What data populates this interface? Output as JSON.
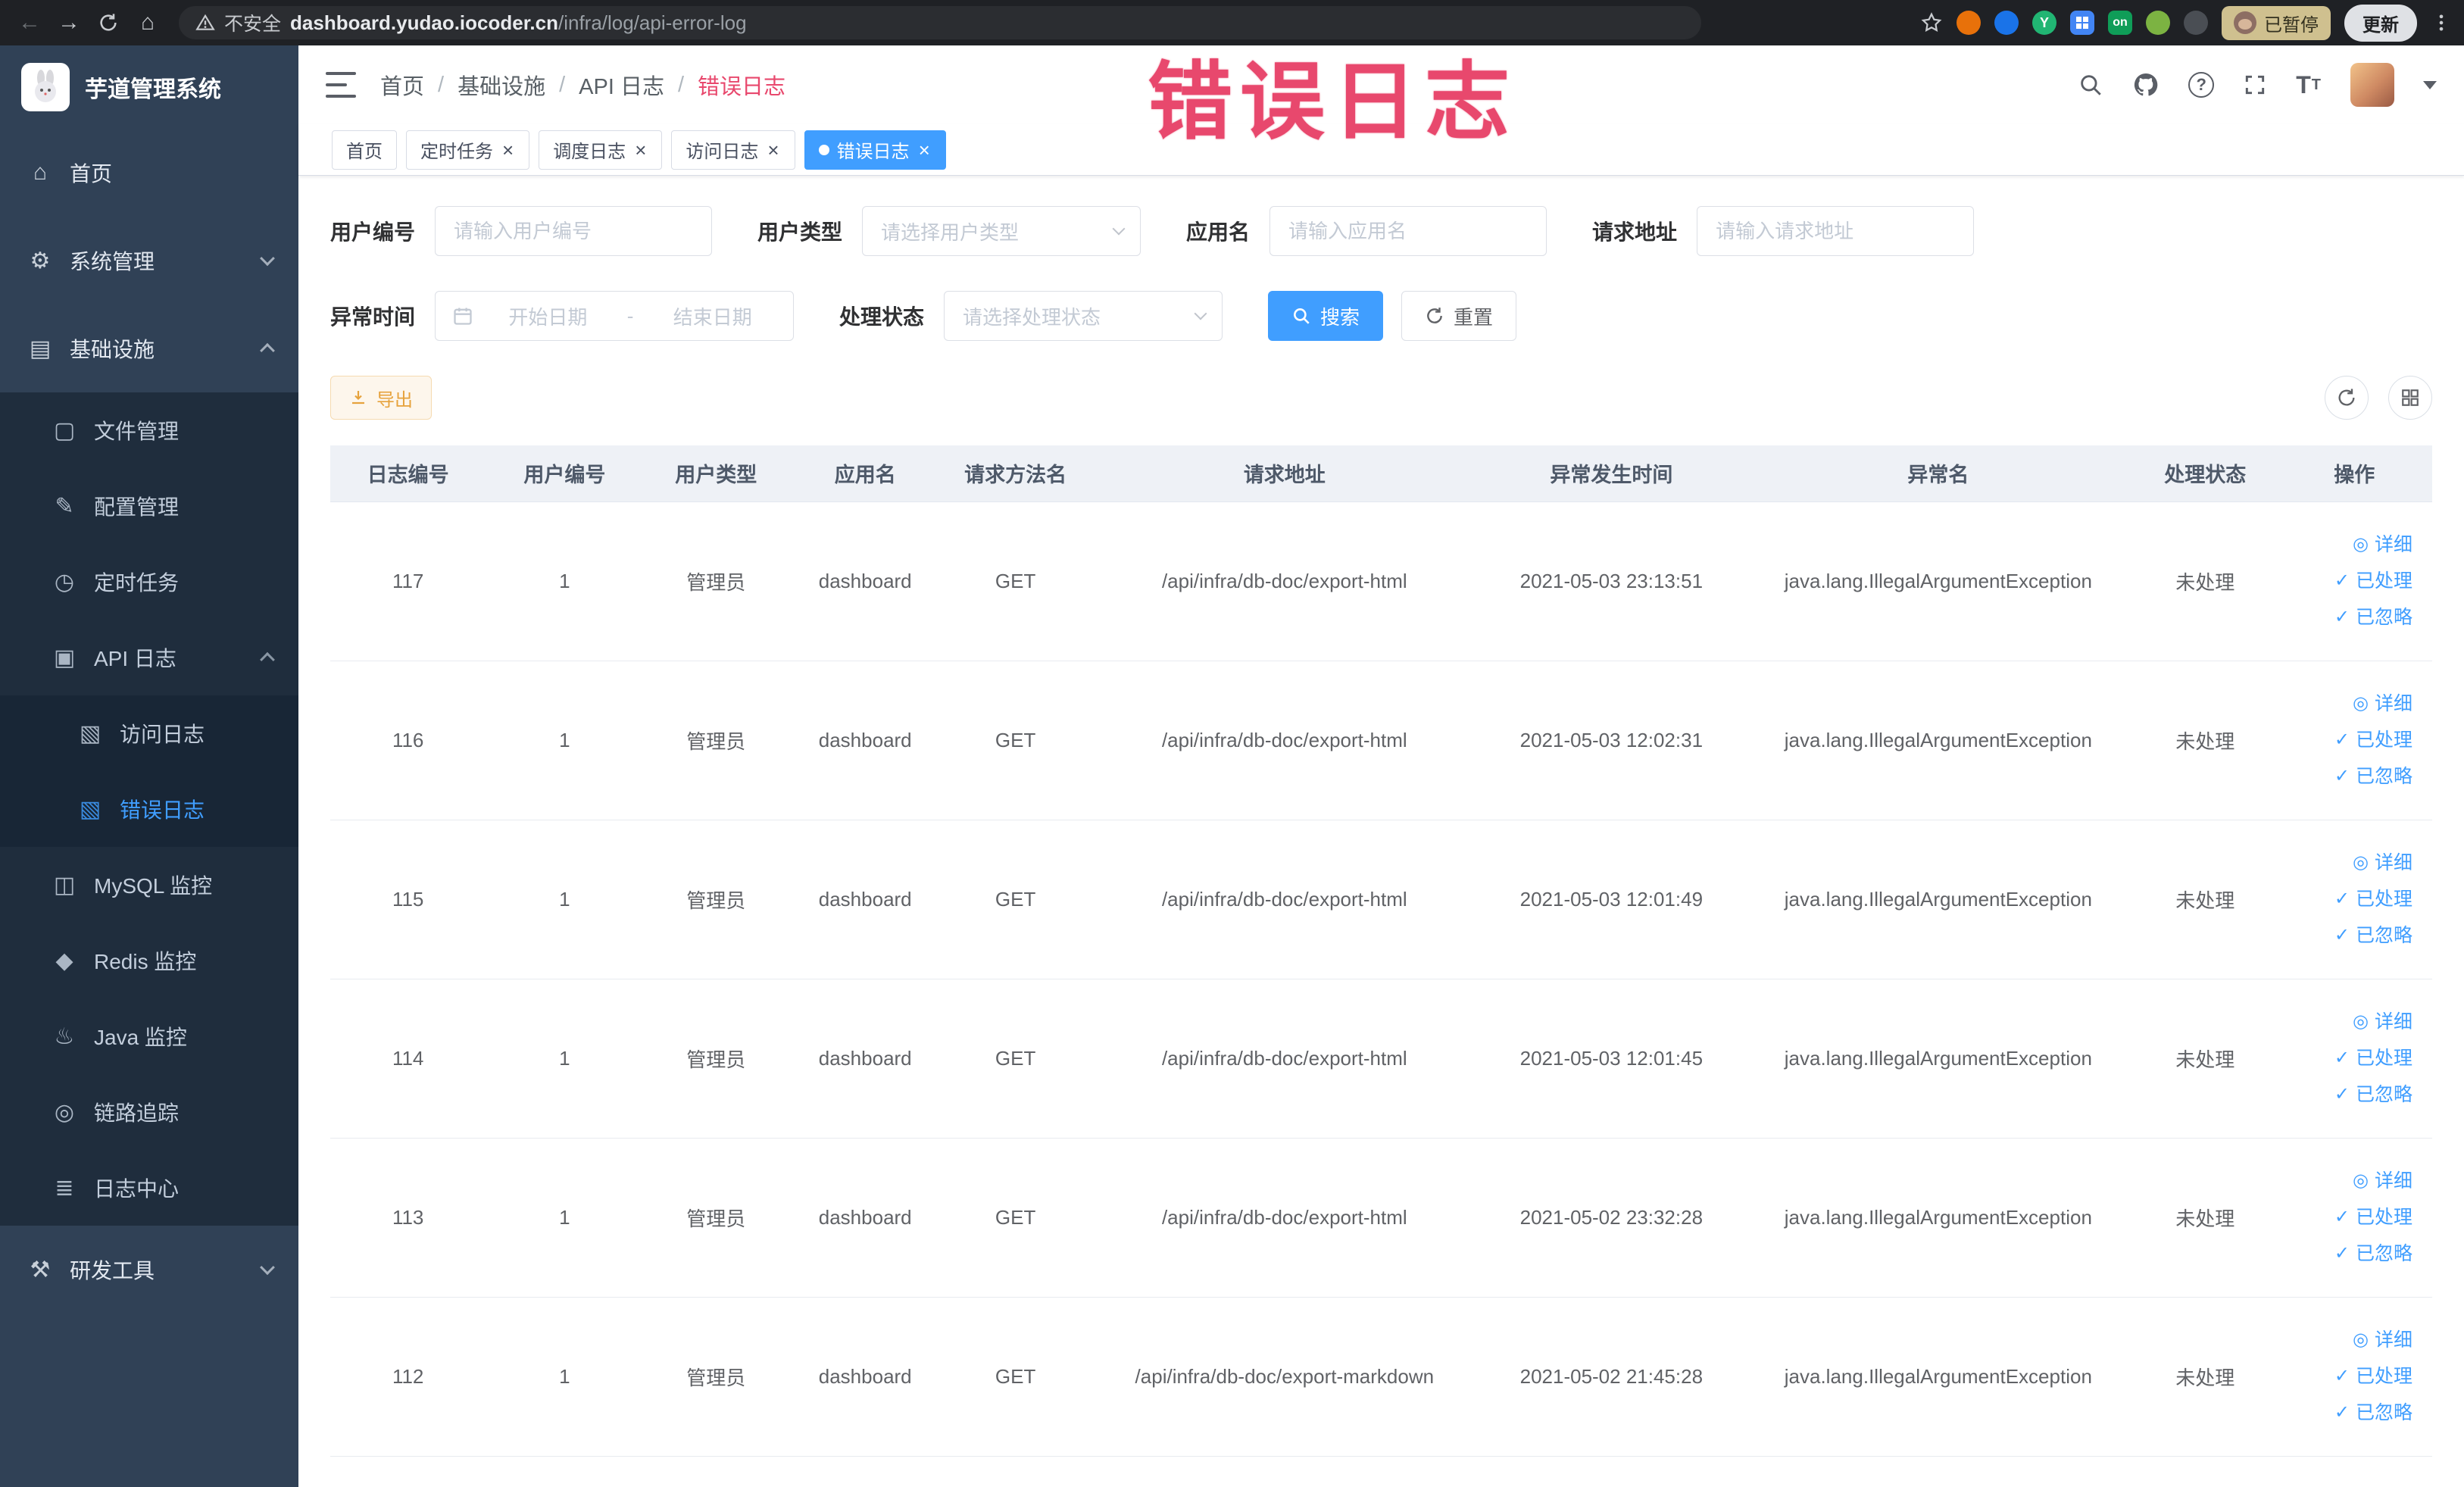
{
  "browser": {
    "security_label": "不安全",
    "url_domain": "dashboard.yudao.iocoder.cn",
    "url_path": "/infra/log/api-error-log",
    "extension_y_label": "Y",
    "extension_on_label": "on",
    "paused_badge": "已暂停",
    "update_button": "更新"
  },
  "watermark": "错误日志",
  "sidebar": {
    "logo_title": "芋道管理系统",
    "items": [
      {
        "label": "首页",
        "level": 1,
        "icon": "home-icon"
      },
      {
        "label": "系统管理",
        "level": 1,
        "icon": "system-icon",
        "chevron": "down"
      },
      {
        "label": "基础设施",
        "level": 1,
        "icon": "infrastructure-icon",
        "chevron": "up"
      },
      {
        "label": "文件管理",
        "level": 2,
        "icon": "file-icon"
      },
      {
        "label": "配置管理",
        "level": 2,
        "icon": "config-icon"
      },
      {
        "label": "定时任务",
        "level": 2,
        "icon": "job-icon"
      },
      {
        "label": "API 日志",
        "level": 2,
        "icon": "api-log-icon",
        "chevron": "up"
      },
      {
        "label": "访问日志",
        "level": 3,
        "icon": "access-log-icon"
      },
      {
        "label": "错误日志",
        "level": 3,
        "icon": "error-log-icon",
        "active": true
      },
      {
        "label": "MySQL 监控",
        "level": 2,
        "icon": "mysql-icon"
      },
      {
        "label": "Redis 监控",
        "level": 2,
        "icon": "redis-icon"
      },
      {
        "label": "Java 监控",
        "level": 2,
        "icon": "java-icon"
      },
      {
        "label": "链路追踪",
        "level": 2,
        "icon": "trace-icon"
      },
      {
        "label": "日志中心",
        "level": 2,
        "icon": "log-center-icon"
      },
      {
        "label": "研发工具",
        "level": 1,
        "icon": "tools-icon",
        "chevron": "down"
      }
    ]
  },
  "header": {
    "breadcrumb": [
      "首页",
      "基础设施",
      "API 日志",
      "错误日志"
    ]
  },
  "tabs": [
    {
      "label": "首页",
      "closable": false,
      "active": false
    },
    {
      "label": "定时任务",
      "closable": true,
      "active": false
    },
    {
      "label": "调度日志",
      "closable": true,
      "active": false
    },
    {
      "label": "访问日志",
      "closable": true,
      "active": false
    },
    {
      "label": "错误日志",
      "closable": true,
      "active": true
    }
  ],
  "filters": {
    "user_id": {
      "label": "用户编号",
      "placeholder": "请输入用户编号"
    },
    "user_type": {
      "label": "用户类型",
      "placeholder": "请选择用户类型"
    },
    "app_name": {
      "label": "应用名",
      "placeholder": "请输入应用名"
    },
    "request_url": {
      "label": "请求地址",
      "placeholder": "请输入请求地址"
    },
    "exception_time": {
      "label": "异常时间",
      "start_placeholder": "开始日期",
      "separator": "-",
      "end_placeholder": "结束日期"
    },
    "process_status": {
      "label": "处理状态",
      "placeholder": "请选择处理状态"
    },
    "search_button": "搜索",
    "reset_button": "重置"
  },
  "toolbar": {
    "export_button": "导出"
  },
  "table": {
    "columns": [
      "日志编号",
      "用户编号",
      "用户类型",
      "应用名",
      "请求方法名",
      "请求地址",
      "异常发生时间",
      "异常名",
      "处理状态",
      "操作"
    ],
    "rows": [
      {
        "log_id": "117",
        "user_id": "1",
        "user_type": "管理员",
        "app_name": "dashboard",
        "method": "GET",
        "url": "/api/infra/db-doc/export-html",
        "time": "2021-05-03 23:13:51",
        "exception": "java.lang.IllegalArgumentException",
        "status": "未处理"
      },
      {
        "log_id": "116",
        "user_id": "1",
        "user_type": "管理员",
        "app_name": "dashboard",
        "method": "GET",
        "url": "/api/infra/db-doc/export-html",
        "time": "2021-05-03 12:02:31",
        "exception": "java.lang.IllegalArgumentException",
        "status": "未处理"
      },
      {
        "log_id": "115",
        "user_id": "1",
        "user_type": "管理员",
        "app_name": "dashboard",
        "method": "GET",
        "url": "/api/infra/db-doc/export-html",
        "time": "2021-05-03 12:01:49",
        "exception": "java.lang.IllegalArgumentException",
        "status": "未处理"
      },
      {
        "log_id": "114",
        "user_id": "1",
        "user_type": "管理员",
        "app_name": "dashboard",
        "method": "GET",
        "url": "/api/infra/db-doc/export-html",
        "time": "2021-05-03 12:01:45",
        "exception": "java.lang.IllegalArgumentException",
        "status": "未处理"
      },
      {
        "log_id": "113",
        "user_id": "1",
        "user_type": "管理员",
        "app_name": "dashboard",
        "method": "GET",
        "url": "/api/infra/db-doc/export-html",
        "time": "2021-05-02 23:32:28",
        "exception": "java.lang.IllegalArgumentException",
        "status": "未处理"
      },
      {
        "log_id": "112",
        "user_id": "1",
        "user_type": "管理员",
        "app_name": "dashboard",
        "method": "GET",
        "url": "/api/infra/db-doc/export-markdown",
        "time": "2021-05-02 21:45:28",
        "exception": "java.lang.IllegalArgumentException",
        "status": "未处理"
      }
    ],
    "row_actions": [
      {
        "label": "详细",
        "icon": "view-detail-icon"
      },
      {
        "label": "已处理",
        "icon": "check-icon"
      },
      {
        "label": "已忽略",
        "icon": "check-icon"
      }
    ]
  },
  "icons": {
    "home-icon": "⌂",
    "system-icon": "⚙",
    "infrastructure-icon": "▤",
    "file-icon": "▢",
    "config-icon": "✎",
    "job-icon": "◷",
    "api-log-icon": "▣",
    "access-log-icon": "▧",
    "error-log-icon": "▧",
    "mysql-icon": "◫",
    "redis-icon": "◆",
    "java-icon": "♨",
    "trace-icon": "◎",
    "log-center-icon": "≣",
    "tools-icon": "⚒",
    "view-detail-icon": "◎",
    "check-icon": "✓"
  }
}
